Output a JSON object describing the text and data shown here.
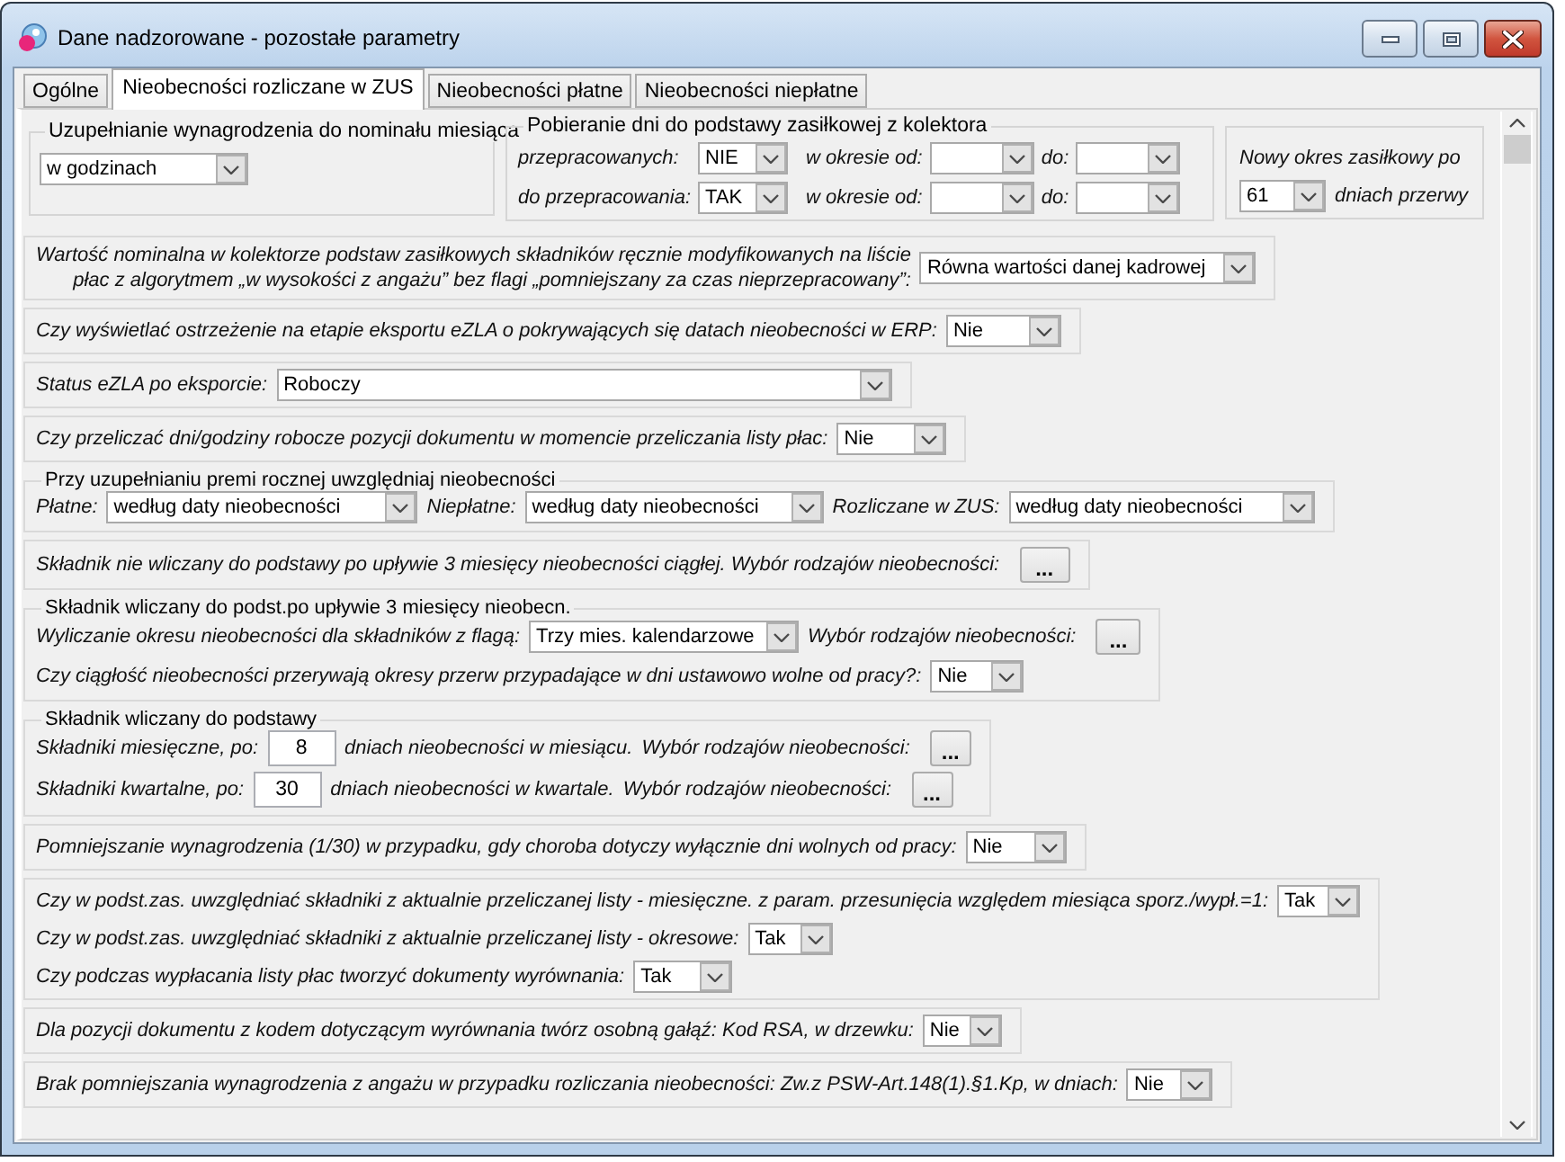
{
  "window": {
    "title": "Dane nadzorowane - pozostałe parametry"
  },
  "tabs": [
    {
      "label": "Ogólne",
      "selected": false
    },
    {
      "label": "Nieobecności rozliczane w ZUS",
      "selected": true
    },
    {
      "label": "Nieobecności płatne",
      "selected": false
    },
    {
      "label": "Nieobecności niepłatne",
      "selected": false
    }
  ],
  "top_groups": [
    {
      "kind": "select_group",
      "title": "Uzupełnianie wynagrodzenia do nominału miesiąca",
      "value": "w godzinach"
    },
    {
      "kind": "collector_group",
      "title": "Pobieranie dni do podstawy zasiłkowej z kolektora",
      "rows": [
        {
          "label": "przepracowanych:",
          "value": "NIE",
          "from_label": "w okresie od:",
          "to_label": "do:"
        },
        {
          "label": "do przepracowania:",
          "value": "TAK",
          "from_label": "w okresie od:",
          "to_label": "do:"
        }
      ]
    },
    {
      "kind": "period_group",
      "label": "Nowy okres zasiłkowy po",
      "value": "61",
      "suffix": "dniach przerwy"
    }
  ],
  "sections": [
    {
      "kind": "panel",
      "rows": [
        {
          "items": [
            {
              "kind": "label",
              "text": "Wartość nominalna w kolektorze podstaw zasiłkowych składników ręcznie modyfikowanych na liście\npłac z algorytmem „w wysokości z angażu” bez flagi „pomniejszany za czas nieprzepracowany”:"
            },
            {
              "kind": "select",
              "value": "Równa wartości danej kadrowej"
            }
          ]
        }
      ]
    },
    {
      "kind": "panel",
      "rows": [
        {
          "items": [
            {
              "kind": "label",
              "text": "Czy wyświetlać ostrzeżenie na etapie eksportu eZLA o pokrywających się datach nieobecności w ERP:"
            },
            {
              "kind": "select",
              "value": "Nie"
            }
          ]
        }
      ]
    },
    {
      "kind": "panel",
      "rows": [
        {
          "items": [
            {
              "kind": "label",
              "text": "Status eZLA po eksporcie:"
            },
            {
              "kind": "select",
              "value": "Roboczy"
            }
          ]
        }
      ]
    },
    {
      "kind": "panel",
      "rows": [
        {
          "items": [
            {
              "kind": "label",
              "text": "Czy przeliczać dni/godziny robocze pozycji dokumentu w momencie przeliczania listy płac:"
            },
            {
              "kind": "select",
              "value": "Nie"
            }
          ]
        }
      ]
    },
    {
      "kind": "group",
      "title": "Przy uzupełnianiu premi rocznej uwzględniaj nieobecności",
      "rows": [
        {
          "items": [
            {
              "kind": "label",
              "text": "Płatne:"
            },
            {
              "kind": "select",
              "value": "według daty nieobecności"
            },
            {
              "kind": "label",
              "text": "Niepłatne:"
            },
            {
              "kind": "select",
              "value": "według daty nieobecności"
            },
            {
              "kind": "label",
              "text": "Rozliczane w ZUS:"
            },
            {
              "kind": "select",
              "value": "według daty nieobecności"
            }
          ]
        }
      ]
    },
    {
      "kind": "panel",
      "rows": [
        {
          "items": [
            {
              "kind": "label",
              "text": "Składnik nie wliczany do podstawy po upływie 3 miesięcy nieobecności ciągłej. Wybór rodzajów nieobecności:"
            },
            {
              "kind": "button",
              "label": "..."
            }
          ]
        }
      ]
    },
    {
      "kind": "group",
      "title": "Składnik wliczany do podst.po upływie 3 miesięcy nieobecn.",
      "rows": [
        {
          "items": [
            {
              "kind": "label",
              "text": "Wyliczanie okresu nieobecności dla składników z flagą:"
            },
            {
              "kind": "select",
              "value": "Trzy mies. kalendarzowe"
            },
            {
              "kind": "label",
              "text": "Wybór rodzajów nieobecności:"
            },
            {
              "kind": "button",
              "label": "..."
            }
          ]
        },
        {
          "items": [
            {
              "kind": "label",
              "text": "Czy ciągłość nieobecności przerywają okresy przerw przypadające w dni ustawowo wolne od pracy?:"
            },
            {
              "kind": "select",
              "value": "Nie"
            }
          ]
        }
      ]
    },
    {
      "kind": "group",
      "title": "Składnik wliczany do podstawy",
      "rows": [
        {
          "items": [
            {
              "kind": "label",
              "text": "Składniki miesięczne, po:"
            },
            {
              "kind": "number",
              "value": "8"
            },
            {
              "kind": "label",
              "text": "dniach nieobecności w miesiącu."
            },
            {
              "kind": "label",
              "text": "Wybór rodzajów nieobecności:"
            },
            {
              "kind": "button",
              "label": "..."
            }
          ]
        },
        {
          "items": [
            {
              "kind": "label",
              "text": "Składniki kwartalne, po:"
            },
            {
              "kind": "number",
              "value": "30"
            },
            {
              "kind": "label",
              "text": "dniach nieobecności w kwartale."
            },
            {
              "kind": "label",
              "text": "Wybór rodzajów nieobecności:"
            },
            {
              "kind": "button",
              "label": "..."
            }
          ]
        }
      ]
    },
    {
      "kind": "panel",
      "rows": [
        {
          "items": [
            {
              "kind": "label",
              "text": "Pomniejszanie wynagrodzenia (1/30) w przypadku, gdy choroba dotyczy wyłącznie dni wolnych od pracy:"
            },
            {
              "kind": "select",
              "value": "Nie"
            }
          ]
        }
      ]
    },
    {
      "kind": "panel",
      "rows": [
        {
          "items": [
            {
              "kind": "label",
              "text": "Czy w podst.zas. uwzględniać składniki z aktualnie przeliczanej listy - miesięczne. z param. przesunięcia względem miesiąca sporz./wypł.=1:"
            },
            {
              "kind": "select",
              "value": "Tak"
            }
          ]
        },
        {
          "items": [
            {
              "kind": "label",
              "text": "Czy w podst.zas. uwzględniać składniki z aktualnie przeliczanej listy - okresowe:"
            },
            {
              "kind": "select",
              "value": "Tak"
            }
          ]
        },
        {
          "items": [
            {
              "kind": "label",
              "text": "Czy podczas wypłacania listy płac tworzyć dokumenty wyrównania:"
            },
            {
              "kind": "select",
              "value": "Tak"
            }
          ]
        }
      ]
    },
    {
      "kind": "panel",
      "rows": [
        {
          "items": [
            {
              "kind": "label",
              "text": "Dla pozycji dokumentu z kodem dotyczącym wyrównania twórz osobną gałąź: Kod RSA, w drzewku:"
            },
            {
              "kind": "select",
              "value": "Nie"
            }
          ]
        }
      ]
    },
    {
      "kind": "panel",
      "rows": [
        {
          "items": [
            {
              "kind": "label",
              "text": "Brak pomniejszania wynagrodzenia z angażu w przypadku rozliczania nieobecności: Zw.z PSW-Art.148(1).§1.Kp, w dniach:"
            },
            {
              "kind": "select",
              "value": "Nie"
            }
          ]
        }
      ]
    }
  ]
}
